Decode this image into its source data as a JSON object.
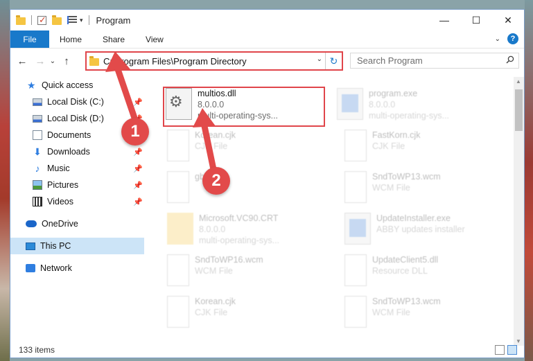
{
  "window": {
    "title": "Program",
    "controls": {
      "minimize": "—",
      "maximize": "☐",
      "close": "✕"
    }
  },
  "ribbon": {
    "tabs": [
      {
        "label": "File"
      },
      {
        "label": "Home"
      },
      {
        "label": "Share"
      },
      {
        "label": "View"
      }
    ]
  },
  "nav": {
    "back": "←",
    "forward": "→",
    "recent": "⌄",
    "up": "↑"
  },
  "address": {
    "path": "C:\\Program Files\\Program Directory"
  },
  "search": {
    "placeholder": "Search Program"
  },
  "sidebar": {
    "items": [
      {
        "label": "Quick access",
        "icon": "star-icon"
      },
      {
        "label": "Local Disk (C:)",
        "icon": "drive-icon",
        "pinned": true
      },
      {
        "label": "Local Disk (D:)",
        "icon": "drive-icon",
        "pinned": true
      },
      {
        "label": "Documents",
        "icon": "documents-icon",
        "pinned": true
      },
      {
        "label": "Downloads",
        "icon": "downloads-icon",
        "pinned": true
      },
      {
        "label": "Music",
        "icon": "music-icon",
        "pinned": true
      },
      {
        "label": "Pictures",
        "icon": "pictures-icon",
        "pinned": true
      },
      {
        "label": "Videos",
        "icon": "videos-icon",
        "pinned": true
      },
      {
        "label": "OneDrive",
        "icon": "cloud-icon"
      },
      {
        "label": "This PC",
        "icon": "computer-icon",
        "selected": true
      },
      {
        "label": "Network",
        "icon": "network-icon"
      }
    ]
  },
  "files": [
    {
      "name": "multios.dll",
      "line2": "8.0.0.0",
      "line3": "multi-operating-sys...",
      "type": "dll",
      "highlighted": true
    },
    {
      "name": "program.exe",
      "line2": "8.0.0.0",
      "line3": "multi-operating-sys...",
      "type": "exe"
    },
    {
      "name": "Korean.cjk",
      "line2": "CJK File",
      "line3": "",
      "type": "doc"
    },
    {
      "name": "FastKorn.cjk",
      "line2": "CJK File",
      "line3": "",
      "type": "doc"
    },
    {
      "name": "gbk.cjk",
      "line2": "",
      "line3": "",
      "type": "doc"
    },
    {
      "name": "SndToWP13.wcm",
      "line2": "WCM File",
      "line3": "",
      "type": "doc"
    },
    {
      "name": "Microsoft.VC90.CRT",
      "line2": "8.0.0.0",
      "line3": "multi-operating-sys...",
      "type": "folder"
    },
    {
      "name": "UpdateInstaller.exe",
      "line2": "ABBY updates installer",
      "line3": "",
      "type": "exe"
    },
    {
      "name": "SndToWP16.wcm",
      "line2": "WCM File",
      "line3": "",
      "type": "doc"
    },
    {
      "name": "UpdateClient5.dll",
      "line2": "Resource DLL",
      "line3": "",
      "type": "doc"
    },
    {
      "name": "Korean.cjk",
      "line2": "CJK File",
      "line3": "",
      "type": "doc"
    },
    {
      "name": "SndToWP13.wcm",
      "line2": "WCM File",
      "line3": "",
      "type": "doc"
    }
  ],
  "status": {
    "count": "133 items"
  },
  "annotations": {
    "step1": "1",
    "step2": "2",
    "color": "#e24a4a"
  }
}
